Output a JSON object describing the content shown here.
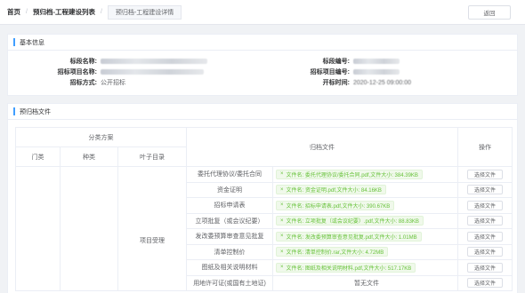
{
  "breadcrumb": {
    "home": "首页",
    "list": "预归档-工程建设列表",
    "current": "预归档-工程建设详情"
  },
  "back_label": "返回",
  "basic": {
    "title": "基本信息",
    "bid_name_label": "标段名称:",
    "project_name_label": "招标项目名称:",
    "method_label": "招标方式:",
    "method_value": "公开招标",
    "bid_no_label": "标段编号:",
    "project_no_label": "招标项目编号:",
    "open_time_label": "开标时间:",
    "open_time_value": "2020-12-25 09:00:00"
  },
  "files": {
    "title": "预归档文件",
    "headers": {
      "scheme": "分类方案",
      "files": "归档文件",
      "ops": "操作",
      "category": "门类",
      "kind": "种类",
      "leaf": "叶子目录"
    },
    "leaf_value": "项目受理",
    "rows": [
      {
        "name": "委托代理协议/委托合同",
        "file": "文件名: 委托代理协议/委托合同.pdf,文件大小: 384.39KB",
        "button": "选择文件"
      },
      {
        "name": "资金证明",
        "file": "文件名: 资金证明.pdf,文件大小: 84.16KB",
        "button": "选择文件"
      },
      {
        "name": "招标申请表",
        "file": "文件名: 招标申请表.pdf,文件大小: 390.67KB",
        "button": "选择文件"
      },
      {
        "name": "立项批复（或会议纪要）",
        "file": "文件名: 立项批复（或会议纪要）.pdf,文件大小: 88.83KB",
        "button": "选择文件"
      },
      {
        "name": "发改委预算审查意见批复",
        "file": "文件名: 发改委预算审查意见批复.pdf,文件大小: 1.01MB",
        "button": "选择文件"
      },
      {
        "name": "清单控制价",
        "file": "文件名: 清单控制价.rar,文件大小: 4.72MB",
        "button": "选择文件"
      },
      {
        "name": "图纸及相关说明材料",
        "file": "文件名: 图纸及相关说明材料.pdf,文件大小: 517.17KB",
        "button": "选择文件"
      },
      {
        "name": "用地许可证(或国有土地证)",
        "file": "",
        "empty_text": "暂无文件",
        "button": "选择文件"
      }
    ]
  },
  "colors": {
    "accent": "#409eff",
    "success": "#67c23a"
  }
}
